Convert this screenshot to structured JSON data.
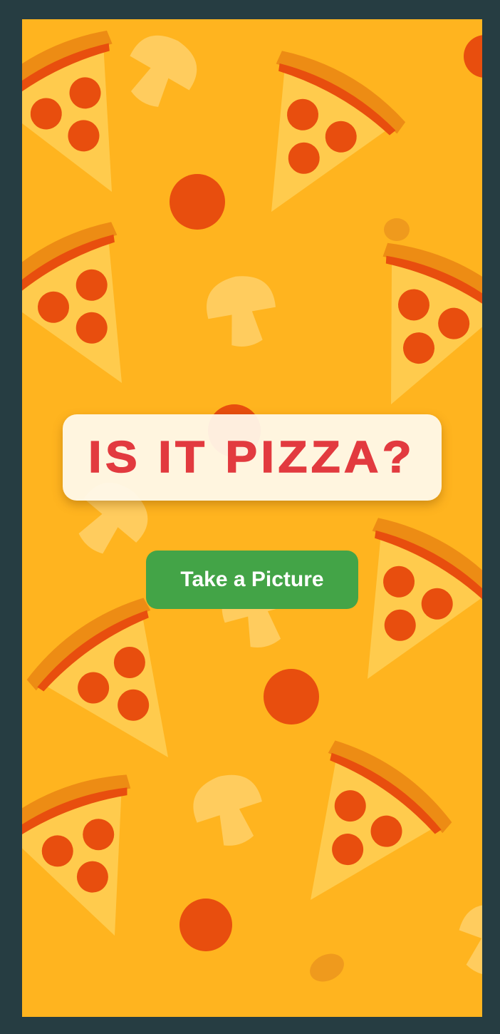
{
  "app": {
    "title": "IS IT PIZZA?",
    "action_label": "Take a Picture"
  },
  "background": {
    "pattern": [
      "pizza-slice-icon",
      "pepperoni-icon",
      "mushroom-icon"
    ]
  },
  "colors": {
    "page_frame": "#263d42",
    "background": "#ffb41f",
    "title_text": "#e23a3f",
    "title_card": "#fff9ec",
    "button": "#43a447",
    "button_text": "#ffffff",
    "pepperoni": "#e84e0e",
    "crust": "#ed8c14",
    "cheese": "#ffcb4d"
  }
}
